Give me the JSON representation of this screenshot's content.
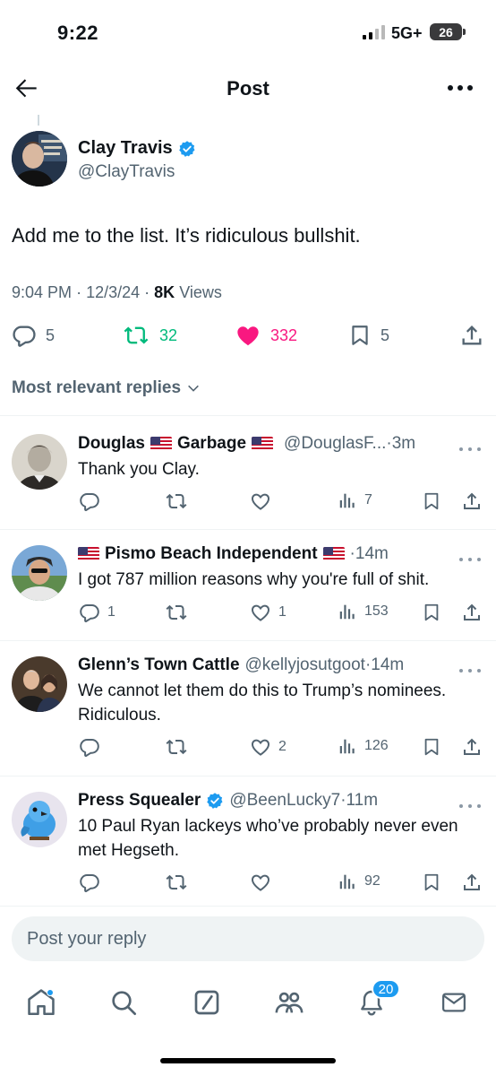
{
  "status_bar": {
    "time": "9:22",
    "network": "5G+",
    "battery": "26"
  },
  "header": {
    "title": "Post",
    "back_icon": "arrow-left-icon",
    "more_icon": "more-horizontal-icon"
  },
  "post": {
    "author_name": "Clay Travis",
    "author_handle": "@ClayTravis",
    "verified": true,
    "text": "Add me to the list. It’s ridiculous bullshit.",
    "time": "9:04 PM",
    "date": "12/3/24",
    "views_count": "8K",
    "views_label": "Views",
    "meta_sep": "·",
    "replies": "5",
    "reposts": "32",
    "likes": "332",
    "bookmarks": "5"
  },
  "relevant_label": "Most relevant replies",
  "replies": [
    {
      "name_parts": [
        "Douglas",
        "Garbage"
      ],
      "handle": "@DouglasF...",
      "time": "·3m",
      "text": "Thank you Clay.",
      "replies": "",
      "likes": "",
      "views": "7"
    },
    {
      "name_parts": [
        "Pismo Beach Independent"
      ],
      "handle": "",
      "time": "·14m",
      "text": "I got 787 million reasons why you're full of shit.",
      "replies": "1",
      "likes": "1",
      "views": "153"
    },
    {
      "name_parts": [
        "Glenn’s Town Cattle"
      ],
      "handle": "@kellyjosutgoot",
      "time": "·14m",
      "text": "We cannot let them do this to Trump’s nominees.  Ridiculous.",
      "replies": "",
      "likes": "2",
      "views": "126"
    },
    {
      "name_parts": [
        "Press Squealer"
      ],
      "handle": "@BeenLucky7",
      "time": "·11m",
      "text": "10 Paul Ryan lackeys who’ve probably never even met Hegseth.",
      "replies": "",
      "likes": "",
      "views": "92"
    }
  ],
  "reply_input": {
    "placeholder": "Post your reply"
  },
  "nav": {
    "notifications_badge": "20"
  },
  "colors": {
    "accent": "#1d9bf0",
    "repost_active": "#00ba7c",
    "like_active": "#f91880",
    "secondary_text": "#536471"
  }
}
